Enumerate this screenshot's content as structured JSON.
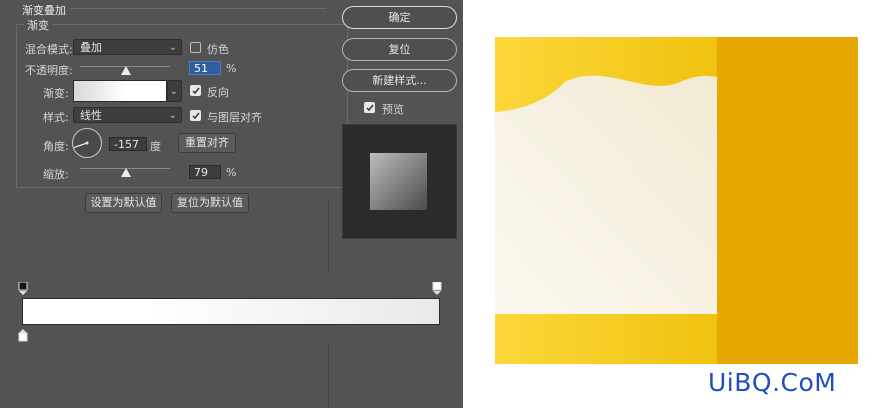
{
  "dialog": {
    "section_title": "渐变叠加",
    "group_title": "渐变",
    "blend_mode": {
      "label": "混合模式:",
      "value": "叠加",
      "dither_label": "仿色",
      "dither_checked": false
    },
    "opacity": {
      "label": "不透明度:",
      "value": "51",
      "unit": "%",
      "fraction": 0.51
    },
    "gradient": {
      "label": "渐变:",
      "reverse_label": "反向",
      "reverse_checked": true
    },
    "style": {
      "label": "样式:",
      "value": "线性",
      "align_label": "与图层对齐",
      "align_checked": true
    },
    "angle": {
      "label": "角度:",
      "value": "-157",
      "unit": "度",
      "reset_label": "重置对齐"
    },
    "scale": {
      "label": "缩放:",
      "value": "79",
      "unit": "%",
      "fraction": 0.79
    },
    "buttons": {
      "make_default": "设置为默认值",
      "reset_default": "复位为默认值"
    }
  },
  "side": {
    "ok": "确定",
    "reset": "复位",
    "new_style": "新建样式...",
    "preview_label": "预览",
    "preview_checked": true
  },
  "colors": {
    "panel": "#535353",
    "yellow_light": "#fdd73a",
    "yellow_dark": "#e6a800",
    "cream": "#f5f0e0",
    "watermark": "#1f4fbf"
  },
  "watermark": "UiBQ.CoM"
}
